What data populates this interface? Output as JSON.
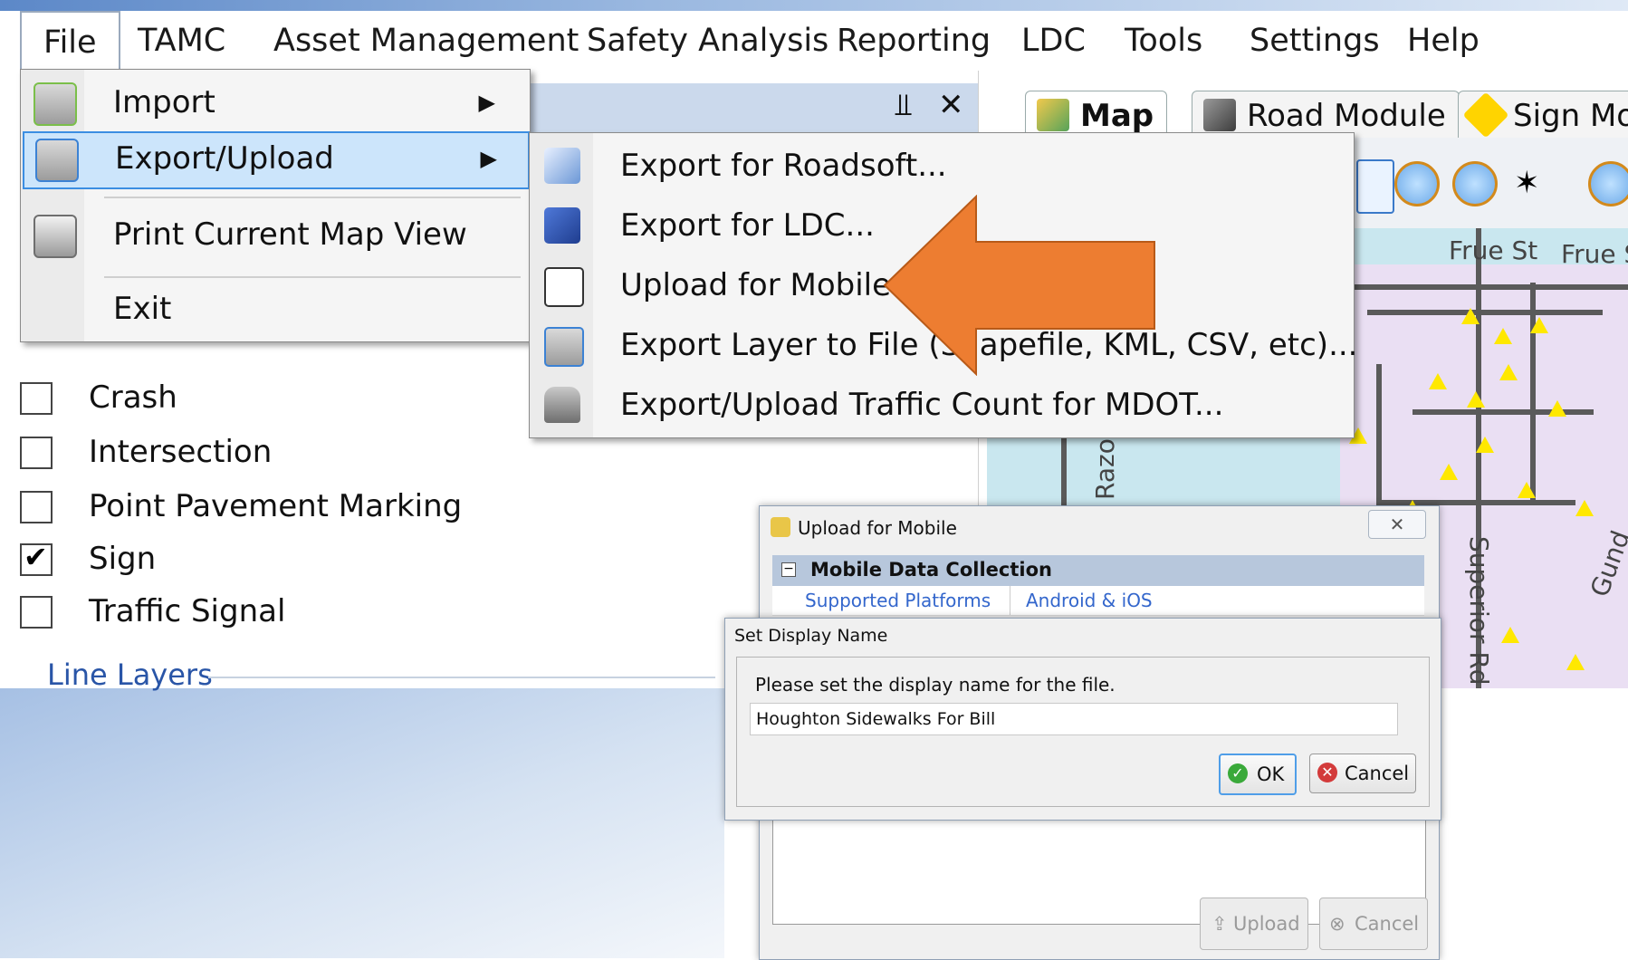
{
  "menubar": {
    "items": [
      "File",
      "TAMC",
      "Asset Management",
      "Safety Analysis",
      "Reporting",
      "LDC",
      "Tools",
      "Settings",
      "Help"
    ]
  },
  "file_menu": {
    "items": [
      {
        "label": "Import",
        "icon": "database-import-icon",
        "submenu": true
      },
      {
        "label": "Export/Upload",
        "icon": "database-save-icon",
        "submenu": true,
        "highlighted": true
      },
      {
        "label": "Print Current Map View",
        "icon": "printer-icon",
        "submenu": false
      },
      {
        "label": "Exit",
        "icon": "",
        "submenu": false
      }
    ]
  },
  "export_submenu": {
    "items": [
      {
        "label": "Export for Roadsoft...",
        "icon": "roadsoft-icon"
      },
      {
        "label": "Export for LDC...",
        "icon": "laptop-icon"
      },
      {
        "label": "Upload for Mobile...",
        "icon": "mobile-devices-icon"
      },
      {
        "label": "Export Layer to File (Shapefile, KML, CSV, etc)...",
        "icon": "database-save-icon"
      },
      {
        "label": "Export/Upload Traffic Count for MDOT...",
        "icon": "car-icon"
      }
    ]
  },
  "panel": {
    "pin_glyph": "⫫",
    "close_glyph": "✕",
    "layers": [
      {
        "label": "Crash",
        "checked": false
      },
      {
        "label": "Intersection",
        "checked": false
      },
      {
        "label": "Point Pavement Marking",
        "checked": false
      },
      {
        "label": "Sign",
        "checked": true
      },
      {
        "label": "Traffic Signal",
        "checked": false
      }
    ],
    "section_label": "Line Layers"
  },
  "map": {
    "tabs": [
      "Map",
      "Road Module",
      "Sign Mo"
    ],
    "street_labels": [
      "Frue St",
      "Frue St",
      "Superior Rd",
      "Razo",
      "Gund"
    ]
  },
  "upload_dialog": {
    "title": "Upload for Mobile",
    "close": "✕",
    "group_label": "Mobile Data Collection",
    "row_key": "Supported Platforms",
    "row_value": "Android & iOS",
    "upload_label": "Upload",
    "cancel_label": "Cancel"
  },
  "name_dialog": {
    "title": "Set Display Name",
    "prompt": "Please set the display name for the file.",
    "value": "Houghton Sidewalks For Bill",
    "ok_label": "OK",
    "cancel_label": "Cancel"
  },
  "colors": {
    "arrow": "#ed7d31",
    "menu_highlight": "#cce5fb",
    "link": "#2955a7"
  }
}
